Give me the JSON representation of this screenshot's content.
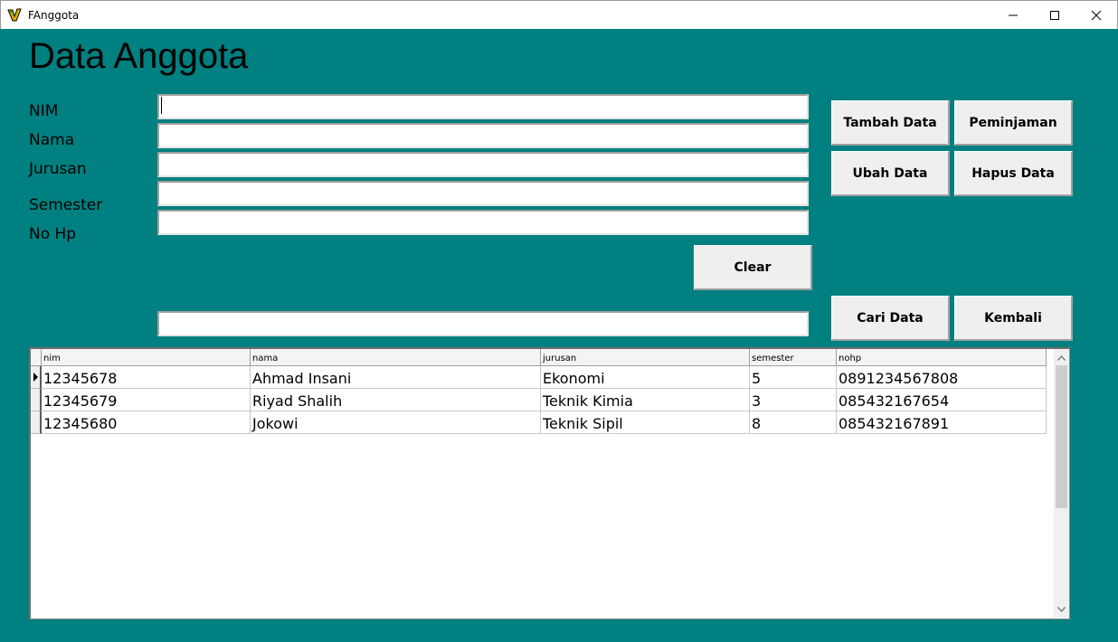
{
  "window": {
    "title": "FAnggota",
    "app_icon": "delphi-app-icon",
    "controls": [
      "minimize-icon",
      "maximize-icon",
      "close-icon"
    ]
  },
  "form": {
    "heading": "Data Anggota",
    "fields": [
      {
        "label": "NIM",
        "value": ""
      },
      {
        "label": "Nama",
        "value": ""
      },
      {
        "label": "Jurusan",
        "value": ""
      },
      {
        "label": "Semester",
        "value": ""
      },
      {
        "label": "No Hp",
        "value": ""
      }
    ],
    "search_value": ""
  },
  "buttons": {
    "tambah": "Tambah Data",
    "peminjaman": "Peminjaman",
    "ubah": "Ubah Data",
    "hapus": "Hapus Data",
    "clear": "Clear",
    "cari": "Cari Data",
    "kembali": "Kembali"
  },
  "grid": {
    "columns": [
      "nim",
      "nama",
      "jurusan",
      "semester",
      "nohp"
    ],
    "rows": [
      [
        "12345678",
        "Ahmad Insani",
        "Ekonomi",
        "5",
        "0891234567808"
      ],
      [
        "12345679",
        "Riyad Shalih",
        "Teknik Kimia",
        "3",
        "085432167654"
      ],
      [
        "12345680",
        "Jokowi",
        "Teknik Sipil",
        "8",
        "085432167891"
      ]
    ],
    "selected_row": 0
  },
  "colors": {
    "form_background": "#008080",
    "button_face": "#efefef"
  }
}
